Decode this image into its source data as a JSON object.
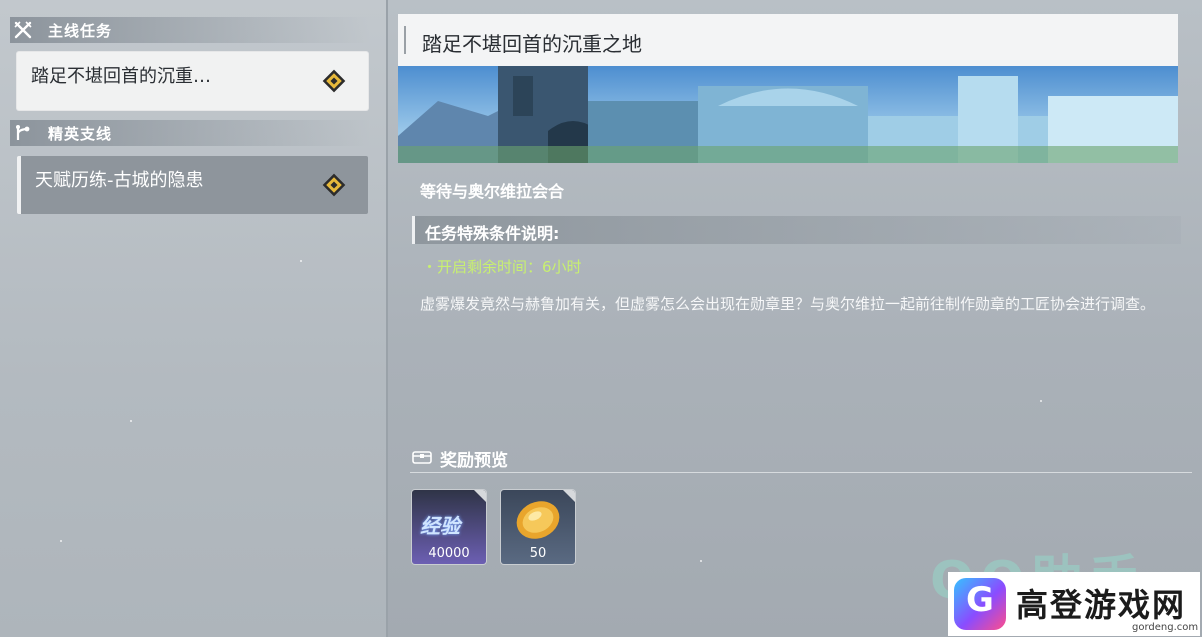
{
  "sidebar": {
    "sections": [
      {
        "label": "主线任务",
        "icon": "crossed-swords-icon"
      },
      {
        "label": "精英支线",
        "icon": "branch-icon"
      }
    ],
    "quests": [
      {
        "title": "踏足不堪回首的沉重…",
        "selected": true
      },
      {
        "title": "天赋历练-古城的隐患",
        "selected": false
      }
    ]
  },
  "detail": {
    "title": "踏足不堪回首的沉重之地",
    "objective": "等待与奥尔维拉会合",
    "conditions_label": "任务特殊条件说明:",
    "time_remaining": "・开启剩余时间：6小时",
    "description": "虚雾爆发竟然与赫鲁加有关，但虚雾怎么会出现在勋章里？与奥尔维拉一起前往制作勋章的工匠协会进行调查。",
    "rewards_label": "奖励预览",
    "rewards": [
      {
        "label": "经验",
        "count": "40000",
        "icon": "exp-icon"
      },
      {
        "count": "50",
        "icon": "gold-coin-icon"
      }
    ]
  },
  "watermark": {
    "text": "QQ助手",
    "brand": "高登游戏网",
    "url": "gordeng.com"
  },
  "colors": {
    "accent_green": "#c8f070",
    "diamond_gold": "#e7b93b"
  }
}
